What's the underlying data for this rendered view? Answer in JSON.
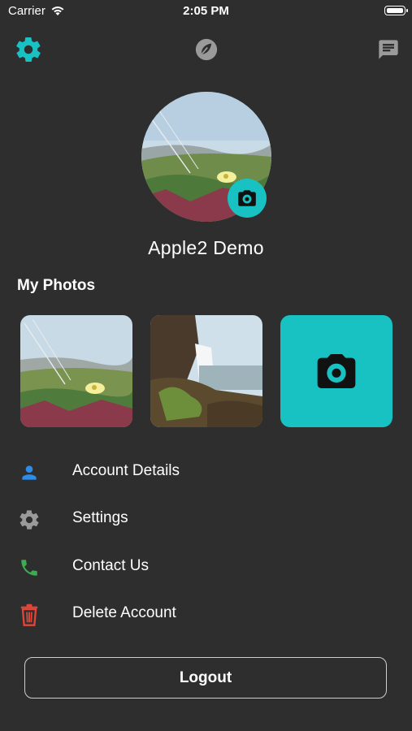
{
  "status_bar": {
    "carrier": "Carrier",
    "time": "2:05 PM"
  },
  "nav": {
    "left_icon": "gear-icon",
    "center_icon": "leaf-icon",
    "right_icon": "chat-icon",
    "accent_color": "#19c2c2"
  },
  "profile": {
    "name": "Apple2 Demo",
    "avatar_icon": "camera-icon"
  },
  "photos": {
    "title": "My Photos",
    "items": [
      "flowers-photo",
      "waterfall-photo"
    ],
    "add_icon": "camera-icon"
  },
  "menu": [
    {
      "label": "Account Details",
      "icon": "person-icon",
      "color": "#2f8be8"
    },
    {
      "label": "Settings",
      "icon": "gear-icon",
      "color": "#9a9a9a"
    },
    {
      "label": "Contact Us",
      "icon": "phone-icon",
      "color": "#3dab4f"
    },
    {
      "label": "Delete Account",
      "icon": "trash-icon",
      "color": "#e0473a"
    }
  ],
  "logout": {
    "label": "Logout"
  }
}
